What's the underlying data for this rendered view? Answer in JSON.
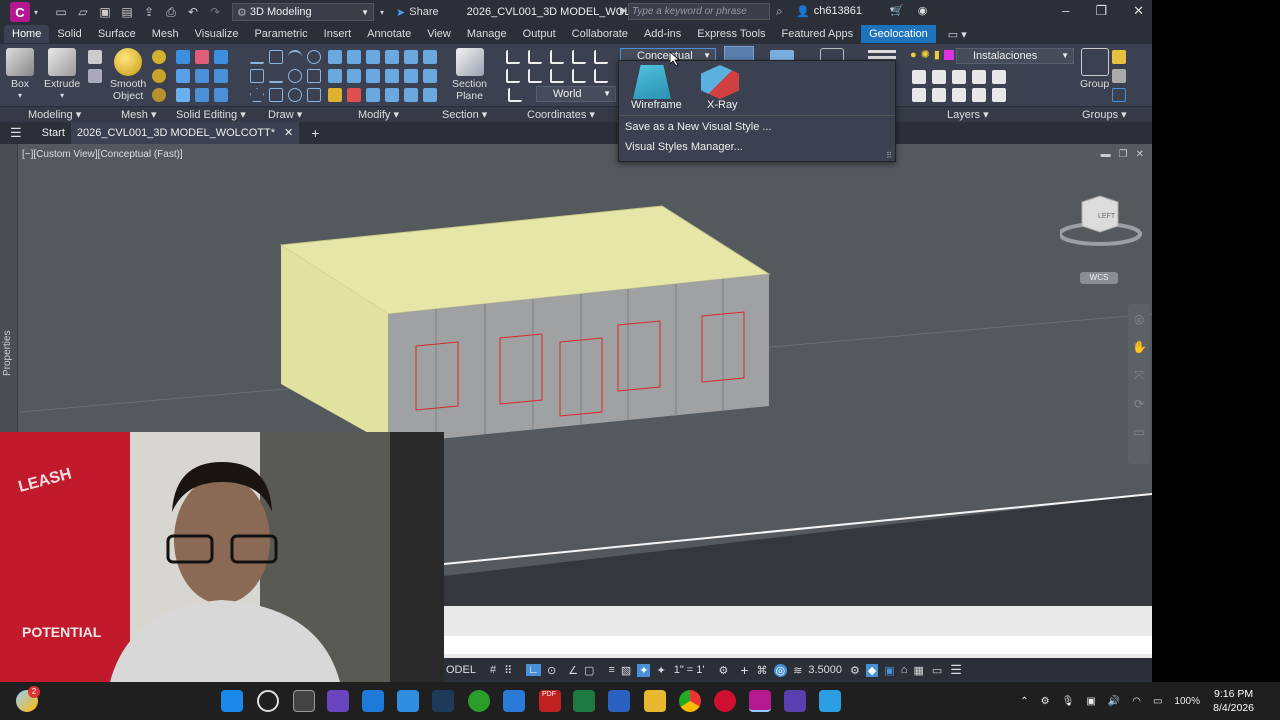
{
  "app": {
    "logo_letter": "C",
    "workspace": "3D Modeling",
    "share_label": "Share",
    "document_title": "2026_CVL001_3D MODEL_WOLCOTT.d...",
    "search_placeholder": "Type a keyword or phrase",
    "user": "ch613861"
  },
  "ribbon_tabs": [
    "Home",
    "Solid",
    "Surface",
    "Mesh",
    "Visualize",
    "Parametric",
    "Insert",
    "Annotate",
    "View",
    "Manage",
    "Output",
    "Collaborate",
    "Add-ins",
    "Express Tools",
    "Featured Apps",
    "Geolocation"
  ],
  "ribbon": {
    "big_buttons": {
      "box": "Box",
      "extrude": "Extrude",
      "smooth_object_1": "Smooth",
      "smooth_object_2": "Object",
      "section_plane_1": "Section",
      "section_plane_2": "Plane",
      "group": "Group"
    },
    "panels": {
      "modeling": "Modeling",
      "mesh": "Mesh",
      "solid_editing": "Solid Editing",
      "draw": "Draw",
      "modify": "Modify",
      "section": "Section",
      "coordinates": "Coordinates",
      "layers": "Layers",
      "groups": "Groups"
    },
    "visual_style_value": "Conceptual",
    "coordinates_value": "World",
    "layer_value": "Instalaciones"
  },
  "visual_style_popup": {
    "styles": [
      "Wireframe",
      "X-Ray"
    ],
    "save_new": "Save as a New Visual Style ...",
    "manager": "Visual Styles Manager..."
  },
  "file_tabs": {
    "start": "Start",
    "active": "2026_CVL001_3D MODEL_WOLCOTT*"
  },
  "viewport": {
    "label": "[−][Custom View][Conceptual (Fast)]",
    "viewcube_face": "LEFT",
    "wcs": "WCS",
    "properties_label": "Properties"
  },
  "statusbar": {
    "model_label": "ODEL",
    "scale": "1\" = 1'",
    "value": "3.5000"
  },
  "webcam": {
    "wall_text_1": "LEASH",
    "wall_text_2": "POTENTIAL"
  },
  "taskbar": {
    "pdf_badge": "PDF",
    "battery": "100%",
    "time": "9:16 PM",
    "date": "8/4/2026",
    "notification_count": "2"
  }
}
